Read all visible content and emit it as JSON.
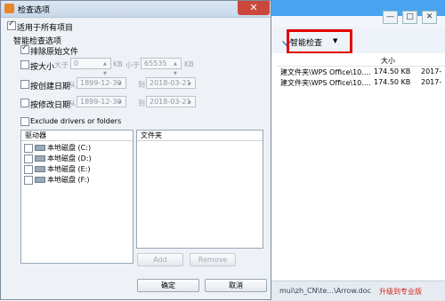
{
  "background_app": {
    "toolbar": {
      "smart_check_label": "智能检查",
      "dropdown_caret": "▼"
    },
    "window_buttons": [
      "—",
      "□",
      "✕"
    ],
    "columns": {
      "size": "大小"
    },
    "rows": [
      {
        "name": "建文件夹\\WPS Office\\10....",
        "size": "174.50 KB",
        "date": "2017-"
      },
      {
        "name": "建文件夹\\WPS Office\\10....",
        "size": "174.50 KB",
        "date": "2017-"
      }
    ],
    "status": {
      "path": "mui\\zh_CN\\te...\\Arrow.doc",
      "upgrade_label": "升级到专业版"
    }
  },
  "dialog": {
    "title": "检查选项",
    "close_glyph": "✕",
    "apply_all_label": "适用于所有项目",
    "smart_group_label": "智能检查选项",
    "exclude_temp_label": "排除原始文件",
    "by_size_label": "按大小",
    "size_gt_label": "大于",
    "size_gt_value": "0",
    "size_lt_label": "小于",
    "size_lt_value": "65535",
    "unit": "KB",
    "by_created_label": "按创建日期",
    "by_modified_label": "按修改日期",
    "from_label": "从",
    "to_label": "到",
    "date_from": "1899-12-30",
    "date_to": "2018-03-21",
    "exclude_drives_label": "Exclude drivers or folders",
    "drives_header": "驱动器",
    "drives": [
      "本地磁盘 (C:)",
      "本地磁盘 (D:)",
      "本地磁盘 (E:)",
      "本地磁盘 (F:)"
    ],
    "folders_header": "文件夹",
    "add_label": "Add",
    "remove_label": "Remove",
    "ok_label": "确定",
    "cancel_label": "取消"
  }
}
